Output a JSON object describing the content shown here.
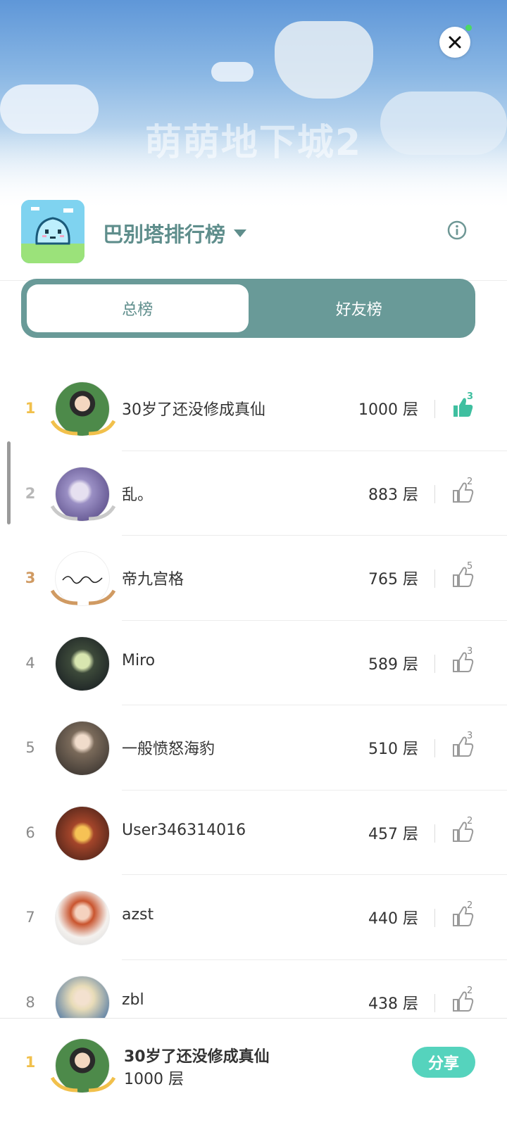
{
  "banner": {
    "game_title": "萌萌地下城2"
  },
  "header": {
    "title": "巴别塔排行榜"
  },
  "tabs": [
    {
      "label": "总榜",
      "active": true
    },
    {
      "label": "好友榜",
      "active": false
    }
  ],
  "unit": "层",
  "colors": {
    "accent": "#699a98",
    "gold": "#f1c04b",
    "silver": "#b8b8b8",
    "bronze": "#d09a62",
    "share": "#55d3bd",
    "liked": "#3fbfa0"
  },
  "rows": [
    {
      "rank": "1",
      "name": "30岁了还没修成真仙",
      "score": "1000 层",
      "likes": "3",
      "liked": true
    },
    {
      "rank": "2",
      "name": "乱。",
      "score": "883 层",
      "likes": "2",
      "liked": false
    },
    {
      "rank": "3",
      "name": "帝九宫格",
      "score": "765 层",
      "likes": "5",
      "liked": false
    },
    {
      "rank": "4",
      "name": "Miro",
      "score": "589 层",
      "likes": "3",
      "liked": false
    },
    {
      "rank": "5",
      "name": "一般愤怒海豹",
      "score": "510 层",
      "likes": "3",
      "liked": false
    },
    {
      "rank": "6",
      "name": "User346314016",
      "score": "457 层",
      "likes": "2",
      "liked": false
    },
    {
      "rank": "7",
      "name": "azst",
      "score": "440 层",
      "likes": "2",
      "liked": false
    },
    {
      "rank": "8",
      "name": "zbl",
      "score": "438 层",
      "likes": "2",
      "liked": false
    }
  ],
  "me": {
    "rank": "1",
    "name": "30岁了还没修成真仙",
    "score": "1000 层",
    "share_label": "分享"
  },
  "icons": {
    "close": "close-icon",
    "info": "info-icon",
    "dropdown": "caret-down-icon",
    "like": "thumbs-up-icon"
  }
}
